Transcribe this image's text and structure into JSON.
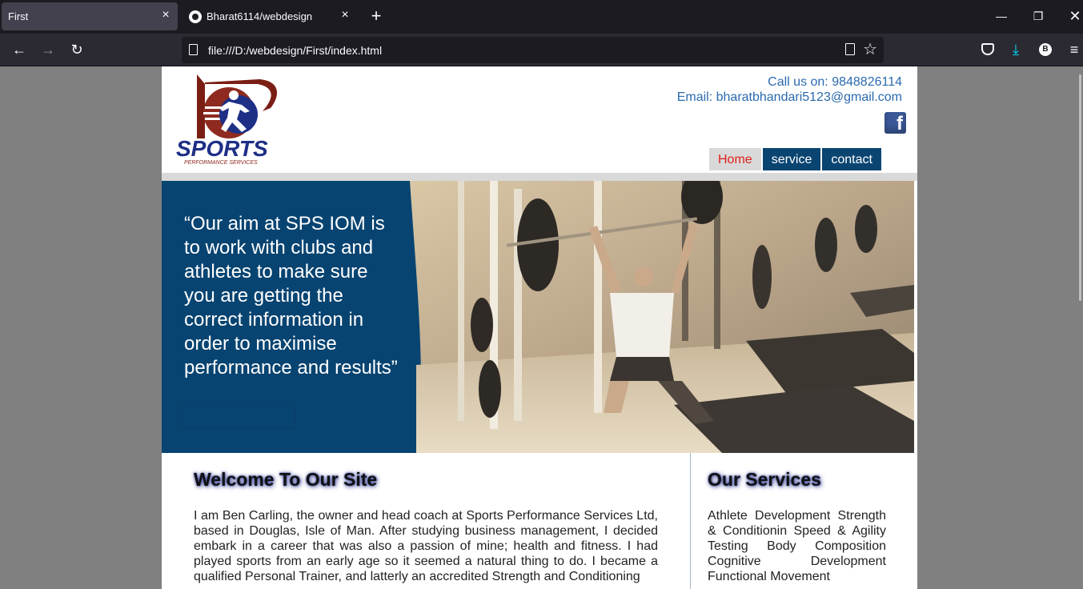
{
  "browser": {
    "tabs": [
      {
        "title": "First",
        "active": true
      },
      {
        "title": "Bharat6114/webdesign",
        "active": false,
        "icon": "github-icon"
      }
    ],
    "url": "file:///D:/webdesign/First/index.html",
    "profile_initial": "B"
  },
  "site": {
    "logo": {
      "text": "SPORTS",
      "subtext": "PERFORMANCE SERVICES"
    },
    "contact": {
      "phone": "Call us on: 9848826114",
      "email": "Email: bharatbhandari5123@gmail.com"
    },
    "social": {
      "facebook_glyph": "f"
    },
    "menu": [
      {
        "label": "Home",
        "active": true
      },
      {
        "label": "service",
        "active": false
      },
      {
        "label": "contact",
        "active": false
      }
    ],
    "banner": {
      "quote": "“Our aim at SPS IOM is to work with clubs and athletes to make sure you are getting the correct information in order to maximise performance and results”"
    },
    "welcome": {
      "heading": "Welcome To Our Site",
      "text": "I am Ben Carling, the owner and head coach at Sports Performance Services Ltd, based in Douglas, Isle of Man. After studying business management, I decided embark in a career that was also a passion of mine; health and fitness. I had played sports from an early age so it seemed a natural thing to do. I became a qualified Personal Trainer, and latterly an accredited Strength and Conditioning"
    },
    "services": {
      "heading": "Our Services",
      "text": "Athlete Development Strength & Conditionin Speed & Agility Testing Body Composition Cognitive Development Functional Movement"
    }
  },
  "colors": {
    "brand_blue": "#084471",
    "link_blue": "#2a6aae",
    "active_red": "#e0201a",
    "facebook": "#3b5998"
  }
}
